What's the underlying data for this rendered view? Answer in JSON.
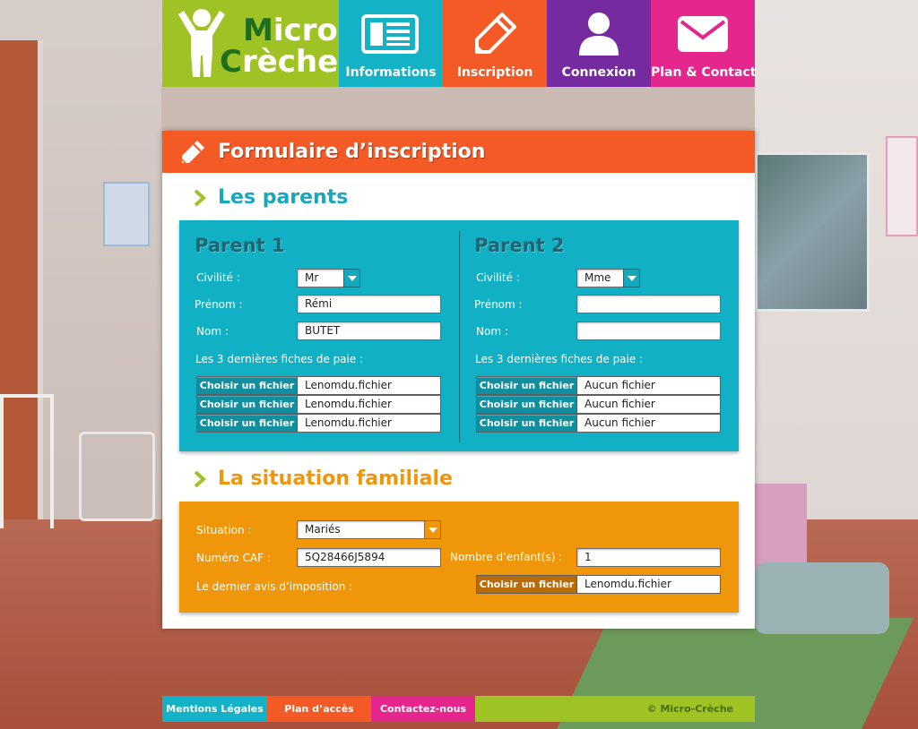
{
  "logo": {
    "line1_cap": "M",
    "line1_rest": "icro",
    "line2_cap": "C",
    "line2_rest": "rèche"
  },
  "nav": [
    {
      "label": "Informations",
      "icon": "newspaper-icon",
      "color": "#14b2c6"
    },
    {
      "label": "Inscription",
      "icon": "pencil-icon",
      "color": "#f35a25"
    },
    {
      "label": "Connexion",
      "icon": "user-icon",
      "color": "#762a9f"
    },
    {
      "label": "Plan & Contact",
      "icon": "envelope-icon",
      "color": "#e5268c"
    }
  ],
  "form": {
    "title": "Formulaire d’inscription",
    "parents_section": "Les parents",
    "family_section": "La situation familiale"
  },
  "parent1": {
    "heading": "Parent 1",
    "civilite_label": "Civilité :",
    "civilite_value": "Mr",
    "prenom_label": "Prénom :",
    "prenom_value": "Rémi",
    "nom_label": "Nom :",
    "nom_value": "BUTET",
    "payslips_label": "Les 3 dernières fiches de paie :",
    "files": [
      {
        "button": "Choisir un fichier",
        "name": "Lenomdu.fichier"
      },
      {
        "button": "Choisir un fichier",
        "name": "Lenomdu.fichier"
      },
      {
        "button": "Choisir un fichier",
        "name": "Lenomdu.fichier"
      }
    ]
  },
  "parent2": {
    "heading": "Parent 2",
    "civilite_label": "Civilité :",
    "civilite_value": "Mme",
    "prenom_label": "Prénom :",
    "prenom_value": "",
    "nom_label": "Nom :",
    "nom_value": "",
    "payslips_label": "Les 3 dernières fiches de paie :",
    "files": [
      {
        "button": "Choisir un fichier",
        "name": "Aucun fichier"
      },
      {
        "button": "Choisir un fichier",
        "name": "Aucun fichier"
      },
      {
        "button": "Choisir un fichier",
        "name": "Aucun fichier"
      }
    ]
  },
  "family": {
    "situation_label": "Situation :",
    "situation_value": "Mariés",
    "caf_label": "Numéro CAF :",
    "caf_value": "5Q28466J5894",
    "children_label": "Nombre d’enfant(s) :",
    "children_value": "1",
    "tax_label": "Le dernier avis d’imposition :",
    "tax_button": "Choisir un fichier",
    "tax_file": "Lenomdu.fichier"
  },
  "footer": {
    "legal": "Mentions Légales",
    "plan": "Plan d’accès",
    "contact": "Contactez-nous",
    "copyright": "© Micro-Crèche"
  },
  "colors": {
    "green": "#9fc324",
    "cyan": "#14b2c6",
    "orange_red": "#f35a25",
    "purple": "#762a9f",
    "pink": "#e5268c",
    "amber": "#f0960a"
  }
}
